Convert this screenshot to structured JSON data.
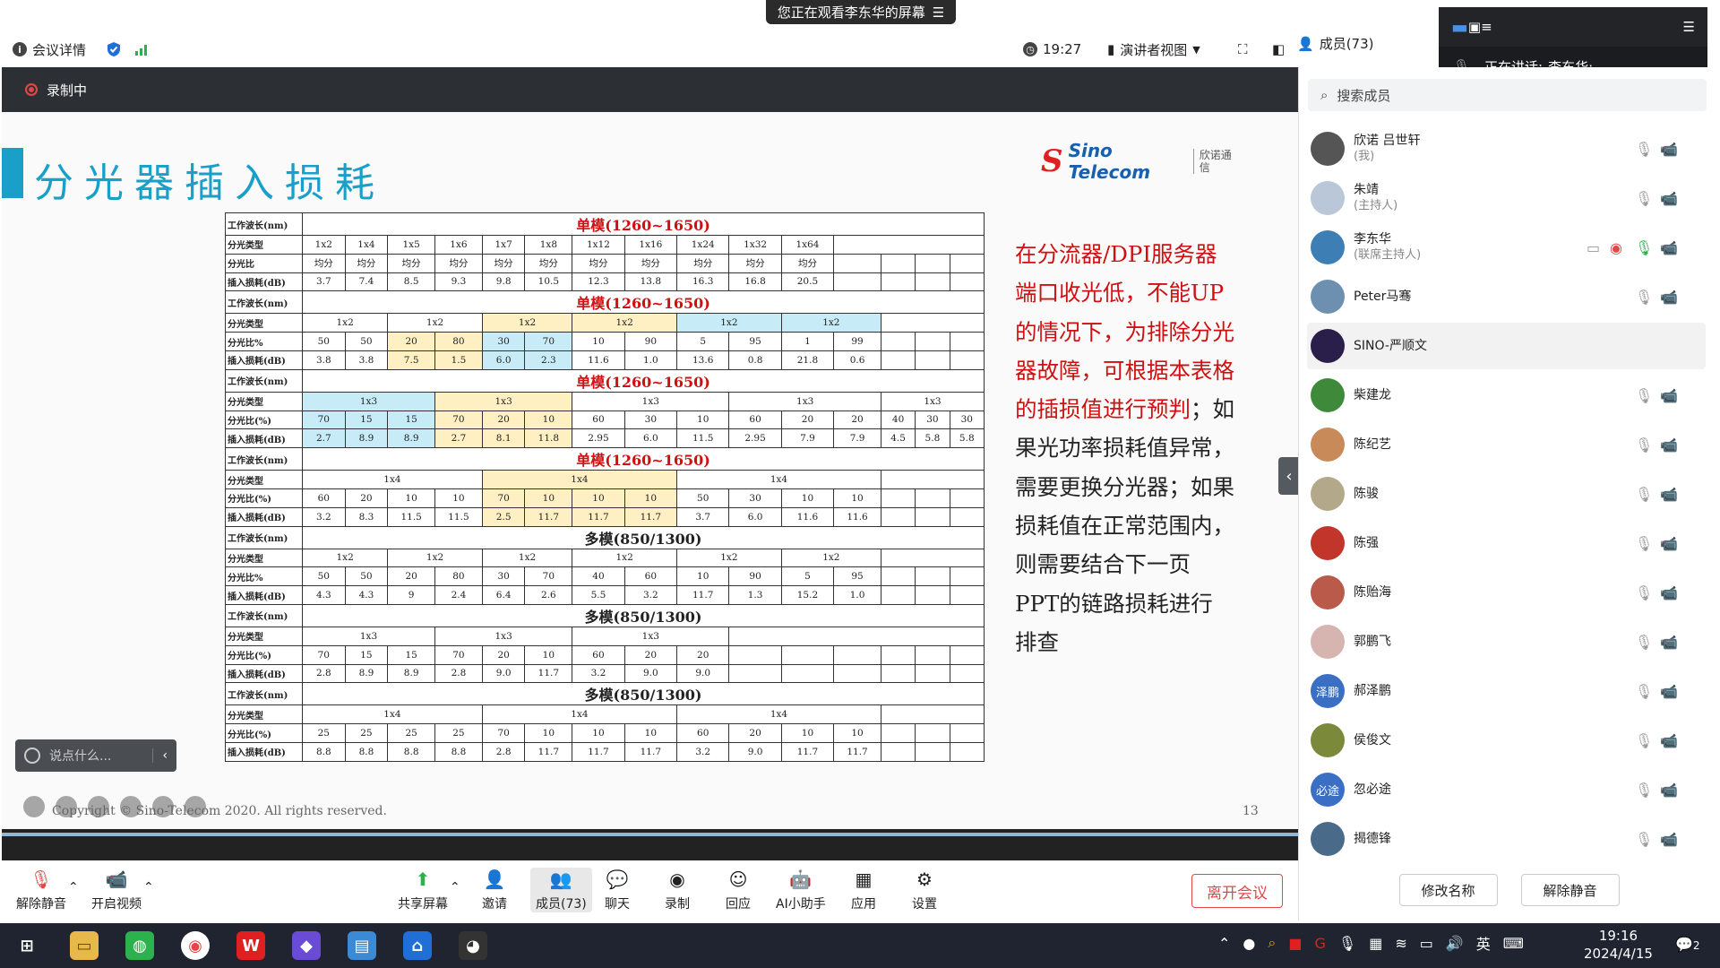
{
  "share_banner": {
    "text": "您正在观看李东华的屏幕",
    "menu_icon": "menu-icon"
  },
  "topbar": {
    "meeting_details": "会议详情",
    "time": "19:27",
    "view_mode": "演讲者视图",
    "members": "成员(73)"
  },
  "recording": {
    "label": "录制中"
  },
  "slide": {
    "title": "分光器插入损耗",
    "logo_text": "Sino Telecom",
    "logo_cn": "欣诺通信",
    "note_red": "在分流器/DPI服务器端口收光低，不能UP的情况下，为排除分光器故障，可根据本表格的插损值进行预判",
    "note_black": "；如果光功率损耗值异常，需要更换分光器；如果损耗值在正常范围内，则需要结合下一页PPT的链路损耗进行排查",
    "copyright": "Copyright © Sino-Telecom 2020. All rights reserved.",
    "page": "13",
    "table": {
      "labels": {
        "wl": "工作波长(nm)",
        "type": "分光类型",
        "ratio": "分光比",
        "ratio_pct": "分光比%",
        "ratio_pct2": "分光比(%)",
        "loss": "插入损耗(dB)"
      },
      "sm": "单模(1260~1650)",
      "mm": "多模(850/1300)",
      "s1_types": [
        "1x2",
        "1x4",
        "1x5",
        "1x6",
        "1x7",
        "1x8",
        "1x12",
        "1x16",
        "1x24",
        "1x32",
        "1x64"
      ],
      "s1_ratio": "均分",
      "s1_loss": [
        "3.7",
        "7.4",
        "8.5",
        "9.3",
        "9.8",
        "10.5",
        "12.3",
        "13.8",
        "16.3",
        "16.8",
        "20.5"
      ],
      "s2_types": [
        "1x2",
        "1x2",
        "1x2",
        "1x2",
        "1x2",
        "1x2"
      ],
      "s2_ratio": [
        "50",
        "50",
        "20",
        "80",
        "30",
        "70",
        "10",
        "90",
        "5",
        "95",
        "1",
        "99"
      ],
      "s2_loss": [
        "3.8",
        "3.8",
        "7.5",
        "1.5",
        "6.0",
        "2.3",
        "11.6",
        "1.0",
        "13.6",
        "0.8",
        "21.8",
        "0.6"
      ],
      "s3_types": [
        "1x3",
        "1x3",
        "1x3",
        "1x3",
        "1x3"
      ],
      "s3_ratio": [
        "70",
        "15",
        "15",
        "70",
        "20",
        "10",
        "60",
        "30",
        "10",
        "60",
        "20",
        "20",
        "40",
        "30",
        "30"
      ],
      "s3_loss": [
        "2.7",
        "8.9",
        "8.9",
        "2.7",
        "8.1",
        "11.8",
        "2.95",
        "6.0",
        "11.5",
        "2.95",
        "7.9",
        "7.9",
        "4.5",
        "5.8",
        "5.8"
      ],
      "s4_types": [
        "1x4",
        "1x4",
        "1x4"
      ],
      "s4_ratio": [
        "60",
        "20",
        "10",
        "10",
        "70",
        "10",
        "10",
        "10",
        "50",
        "30",
        "10",
        "10"
      ],
      "s4_loss": [
        "3.2",
        "8.3",
        "11.5",
        "11.5",
        "2.5",
        "11.7",
        "11.7",
        "11.7",
        "3.7",
        "6.0",
        "11.6",
        "11.6"
      ],
      "s5_types": [
        "1x2",
        "1x2",
        "1x2",
        "1x2",
        "1x2",
        "1x2"
      ],
      "s5_ratio": [
        "50",
        "50",
        "20",
        "80",
        "30",
        "70",
        "40",
        "60",
        "10",
        "90",
        "5",
        "95"
      ],
      "s5_loss": [
        "4.3",
        "4.3",
        "9",
        "2.4",
        "6.4",
        "2.6",
        "5.5",
        "3.2",
        "11.7",
        "1.3",
        "15.2",
        "1.0"
      ],
      "s6_types": [
        "1x3",
        "1x3",
        "1x3"
      ],
      "s6_ratio": [
        "70",
        "15",
        "15",
        "70",
        "20",
        "10",
        "60",
        "20",
        "20"
      ],
      "s6_loss": [
        "2.8",
        "8.9",
        "8.9",
        "2.8",
        "9.0",
        "11.7",
        "3.2",
        "9.0",
        "9.0"
      ],
      "s7_types": [
        "1x4",
        "1x4",
        "1x4"
      ],
      "s7_ratio": [
        "25",
        "25",
        "25",
        "25",
        "70",
        "10",
        "10",
        "10",
        "60",
        "20",
        "10",
        "10"
      ],
      "s7_loss": [
        "8.8",
        "8.8",
        "8.8",
        "8.8",
        "2.8",
        "11.7",
        "11.7",
        "11.7",
        "3.2",
        "9.0",
        "11.7",
        "11.7"
      ]
    }
  },
  "chat_input": {
    "placeholder": "说点什么..."
  },
  "toolbar": {
    "unmute": "解除静音",
    "start_video": "开启视频",
    "share": "共享屏幕",
    "invite": "邀请",
    "members": "成员(73)",
    "chat": "聊天",
    "record": "录制",
    "reactions": "回应",
    "ai": "AI小助手",
    "apps": "应用",
    "settings": "设置",
    "leave": "离开会议"
  },
  "speaking": {
    "label": "正在讲话:",
    "name": "李东华;"
  },
  "member_panel": {
    "search_placeholder": "搜索成员",
    "rename": "修改名称",
    "unmute_all": "解除静音",
    "members": [
      {
        "name": "欣诺 吕世轩",
        "role": "(我)",
        "color": "#555"
      },
      {
        "name": "朱靖",
        "role": "(主持人)",
        "color": "#b9c7d8"
      },
      {
        "name": "李东华",
        "role": "(联席主持人)",
        "color": "#3d7fb5"
      },
      {
        "name": "Peter马骞",
        "role": "",
        "color": "#6d8fb0"
      },
      {
        "name": "SINO-严顺文",
        "role": "",
        "color": "#2a1f4a"
      },
      {
        "name": "柴建龙",
        "role": "",
        "color": "#3e8a3a"
      },
      {
        "name": "陈纪艺",
        "role": "",
        "color": "#c98a5a"
      },
      {
        "name": "陈骏",
        "role": "",
        "color": "#b4a88a"
      },
      {
        "name": "陈强",
        "role": "",
        "color": "#c2352a"
      },
      {
        "name": "陈贻海",
        "role": "",
        "color": "#b95a4a"
      },
      {
        "name": "郭鹏飞",
        "role": "",
        "color": "#d6b4b0"
      },
      {
        "name": "郝泽鹏",
        "role": "",
        "color": "#3b6fc4",
        "initials": "泽鹏"
      },
      {
        "name": "侯俊文",
        "role": "",
        "color": "#7a8a3a"
      },
      {
        "name": "忽必途",
        "role": "",
        "color": "#3b6fc4",
        "initials": "必途"
      },
      {
        "name": "揭德锋",
        "role": "",
        "color": "#4a6a8a"
      }
    ]
  },
  "taskbar": {
    "time": "19:16",
    "date": "2024/4/15",
    "ime": "英",
    "notif": "2"
  },
  "colors": {
    "accent": "#1aa0c8",
    "red": "#d01010",
    "leave": "#e04848"
  }
}
